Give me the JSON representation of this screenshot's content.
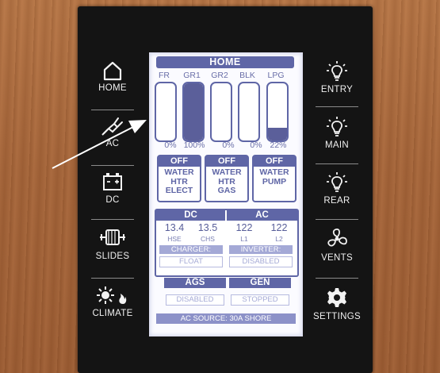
{
  "left_buttons": [
    {
      "label": "HOME",
      "icon": "home-icon"
    },
    {
      "label": "AC",
      "icon": "plug-icon"
    },
    {
      "label": "DC",
      "icon": "battery-icon"
    },
    {
      "label": "SLIDES",
      "icon": "slide-motor-icon"
    },
    {
      "label": "CLIMATE",
      "icon": "climate-sun-flame-icon"
    }
  ],
  "right_buttons": [
    {
      "label": "ENTRY",
      "icon": "lightbulb-icon"
    },
    {
      "label": "MAIN",
      "icon": "lightbulb-icon"
    },
    {
      "label": "REAR",
      "icon": "lightbulb-icon"
    },
    {
      "label": "VENTS",
      "icon": "fan-icon"
    },
    {
      "label": "SETTINGS",
      "icon": "gear-icon"
    }
  ],
  "screen": {
    "title": "HOME",
    "tanks": [
      {
        "label": "FR",
        "value": "0%",
        "level": 0
      },
      {
        "label": "GR1",
        "value": "100%",
        "level": 1.0
      },
      {
        "label": "GR2",
        "value": "0%",
        "level": 0
      },
      {
        "label": "BLK",
        "value": "0%",
        "level": 0
      },
      {
        "label": "LPG",
        "value": "22%",
        "level": 0.22
      }
    ],
    "switches": [
      {
        "state": "OFF",
        "name": "WATER\nHTR\nELECT"
      },
      {
        "state": "OFF",
        "name": "WATER\nHTR\nGAS"
      },
      {
        "state": "OFF",
        "name": "WATER\nPUMP"
      }
    ],
    "dc": {
      "title": "DC",
      "hse_value": "13.4",
      "hse_label": "HSE",
      "chs_value": "13.5",
      "chs_label": "CHS",
      "charger_label": "CHARGER:",
      "charger_value": "FLOAT"
    },
    "ac": {
      "title": "AC",
      "l1_value": "122",
      "l1_label": "L1",
      "l2_value": "122",
      "l2_label": "L2",
      "inverter_label": "INVERTER:",
      "inverter_value": "DISABLED"
    },
    "ags": {
      "title": "AGS",
      "value": "DISABLED"
    },
    "gen": {
      "title": "GEN",
      "value": "STOPPED"
    },
    "ac_source": "AC SOURCE: 30A SHORE"
  },
  "colors": {
    "screen_accent": "#5f66a6",
    "panel": "#141414",
    "wall": "#a8683c"
  }
}
